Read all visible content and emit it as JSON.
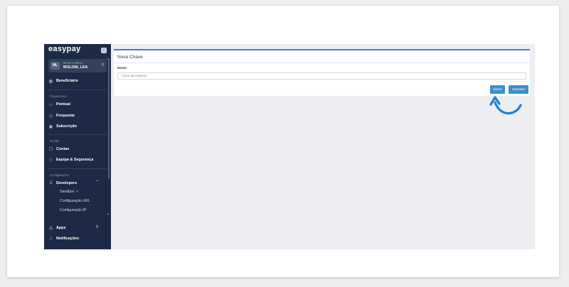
{
  "sidebar": {
    "logo": "easypay",
    "collapse_icon": "collapse-icon",
    "account": {
      "initials": "ML",
      "role": "BENEFICIÁRIO",
      "name": "MOLONI, LDA"
    },
    "top_item": {
      "label": "Beneficiário",
      "icon": "grid-icon"
    },
    "sections": {
      "payments": {
        "title": "Pagamentos",
        "items": [
          {
            "label": "Pontual",
            "icon": "card-icon"
          },
          {
            "label": "Frequente",
            "icon": "clock-icon"
          },
          {
            "label": "Subscrição",
            "icon": "calendar-icon"
          }
        ]
      },
      "management": {
        "title": "Gestão",
        "items": [
          {
            "label": "Contas",
            "icon": "copy-icon"
          },
          {
            "label": "Equipa & Segurança",
            "icon": "users-icon"
          }
        ]
      },
      "settings": {
        "title": "Configurações",
        "developers": {
          "label": "Developers",
          "icon": "code-icon"
        },
        "sub_items": [
          {
            "label": "Sandbox ↗"
          },
          {
            "label": "Configuração URL"
          },
          {
            "label": "Configuração IP"
          }
        ]
      }
    },
    "bottom_items": [
      {
        "label": "Apps",
        "icon": "apps-icon"
      },
      {
        "label": "Notificações",
        "icon": "bell-icon"
      }
    ]
  },
  "form": {
    "title": "Nova Chave",
    "field_label": "Nome",
    "field_value": "nome da empresa",
    "save_label": "Salvar",
    "cancel_label": "Cancelar"
  },
  "colors": {
    "sidebar_bg": "#1d2a45",
    "accent": "#3b8fc9",
    "annotation_arrow": "#1f7fd4"
  }
}
